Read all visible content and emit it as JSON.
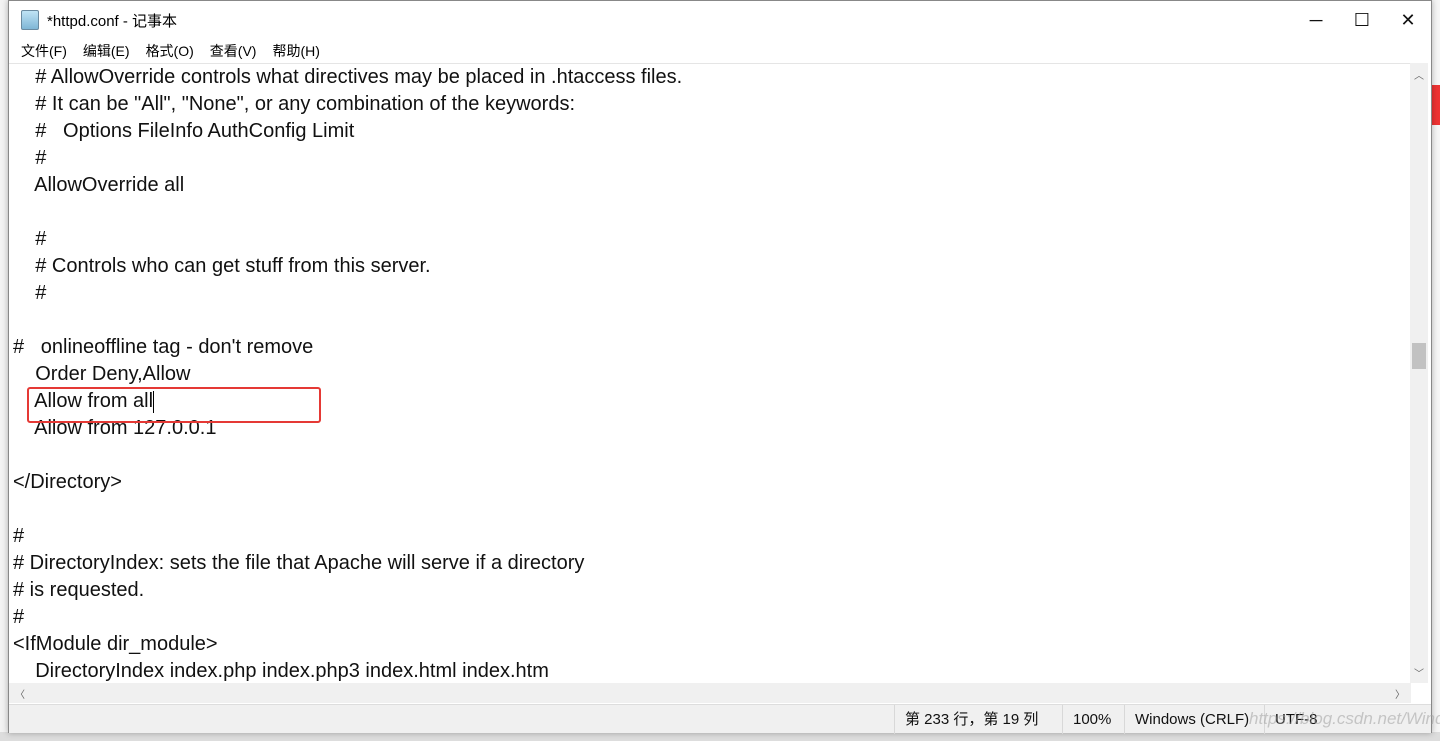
{
  "window": {
    "title": "*httpd.conf - 记事本",
    "controls": {
      "minimize": "─",
      "maximize": "☐",
      "close": "✕"
    }
  },
  "menu": [
    "文件(F)",
    "编辑(E)",
    "格式(O)",
    "查看(V)",
    "帮助(H)"
  ],
  "editor": {
    "lines": [
      "    # AllowOverride controls what directives may be placed in .htaccess files.",
      "    # It can be \"All\", \"None\", or any combination of the keywords:",
      "    #   Options FileInfo AuthConfig Limit",
      "    #",
      "    AllowOverride all",
      "",
      "    #",
      "    # Controls who can get stuff from this server.",
      "    #",
      "",
      "#   onlineoffline tag - don't remove",
      "    Order Deny,Allow",
      "    Allow from all",
      "    Allow from 127.0.0.1",
      "",
      "</Directory>",
      "",
      "#",
      "# DirectoryIndex: sets the file that Apache will serve if a directory",
      "# is requested.",
      "#",
      "<IfModule dir_module>",
      "    DirectoryIndex index.php index.php3 index.html index.htm"
    ],
    "highlight_color": "#e53935"
  },
  "statusbar": {
    "position": "第 233 行，第 19 列",
    "zoom": "100%",
    "line_ending": "Windows (CRLF)",
    "encoding": "UTF-8"
  },
  "watermark": "https://blog.csdn.net/Winda_shi"
}
